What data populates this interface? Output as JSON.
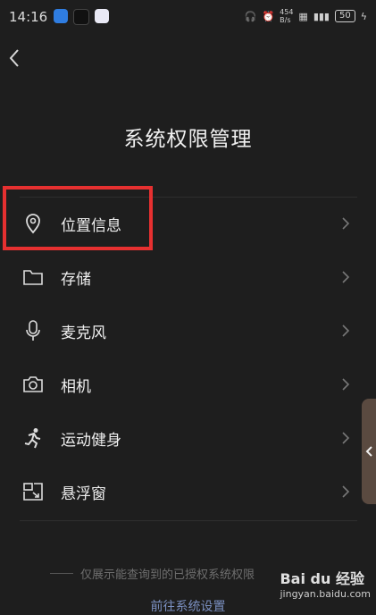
{
  "status": {
    "time": "14:16",
    "network_speed": "454\nB/s",
    "battery": "50"
  },
  "page": {
    "title": "系统权限管理"
  },
  "permissions": [
    {
      "label": "位置信息",
      "icon": "location-pin-icon"
    },
    {
      "label": "存储",
      "icon": "folder-icon"
    },
    {
      "label": "麦克风",
      "icon": "microphone-icon"
    },
    {
      "label": "相机",
      "icon": "camera-icon"
    },
    {
      "label": "运动健身",
      "icon": "running-icon"
    },
    {
      "label": "悬浮窗",
      "icon": "floating-window-icon"
    }
  ],
  "footer": {
    "note": "仅展示能查询到的已授权系统权限",
    "link": "前往系统设置"
  },
  "watermark": {
    "brand": "Bai du 经验",
    "url": "jingyan.baidu.com"
  },
  "colors": {
    "highlight": "#e63030",
    "link": "#7a8fc0"
  }
}
